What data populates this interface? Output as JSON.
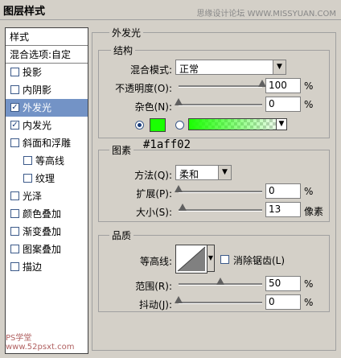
{
  "window": {
    "title": "图层样式",
    "watermark": "思缘设计论坛 WWW.MISSYUAN.COM"
  },
  "sidebar": {
    "header": "样式",
    "blend": "混合选项:自定",
    "items": [
      {
        "label": "投影",
        "checked": false,
        "indent": false
      },
      {
        "label": "内阴影",
        "checked": false,
        "indent": false
      },
      {
        "label": "外发光",
        "checked": true,
        "indent": false,
        "selected": true
      },
      {
        "label": "内发光",
        "checked": true,
        "indent": false
      },
      {
        "label": "斜面和浮雕",
        "checked": false,
        "indent": false
      },
      {
        "label": "等高线",
        "checked": false,
        "indent": true
      },
      {
        "label": "纹理",
        "checked": false,
        "indent": true
      },
      {
        "label": "光泽",
        "checked": false,
        "indent": false
      },
      {
        "label": "颜色叠加",
        "checked": false,
        "indent": false
      },
      {
        "label": "渐变叠加",
        "checked": false,
        "indent": false
      },
      {
        "label": "图案叠加",
        "checked": false,
        "indent": false
      },
      {
        "label": "描边",
        "checked": false,
        "indent": false
      }
    ],
    "footer_watermark": "PS学堂 www.52psxt.com"
  },
  "outer_glow": {
    "title": "外发光",
    "structure": {
      "title": "结构",
      "blend_mode_label": "混合模式:",
      "blend_mode_value": "正常",
      "opacity_label": "不透明度(O):",
      "opacity_value": "100",
      "opacity_level": 100,
      "noise_label": "杂色(N):",
      "noise_value": "0",
      "noise_level": 0,
      "unit": "%",
      "color_hex": "#1aff02"
    },
    "elements": {
      "title": "图素",
      "hex_annotation": "#1aff02",
      "technique_label": "方法(Q):",
      "technique_value": "柔和",
      "spread_label": "扩展(P):",
      "spread_value": "0",
      "spread_level": 0,
      "size_label": "大小(S):",
      "size_value": "13",
      "size_level": 5,
      "unit_pct": "%",
      "unit_px": "像素"
    },
    "quality": {
      "title": "品质",
      "contour_label": "等高线:",
      "antialias_label": "消除锯齿(L)",
      "range_label": "范围(R):",
      "range_value": "50",
      "range_level": 50,
      "jitter_label": "抖动(J):",
      "jitter_value": "0",
      "jitter_level": 0,
      "unit": "%"
    }
  },
  "colors": {
    "accent": "#1aff02",
    "selection": "#7393c6"
  }
}
